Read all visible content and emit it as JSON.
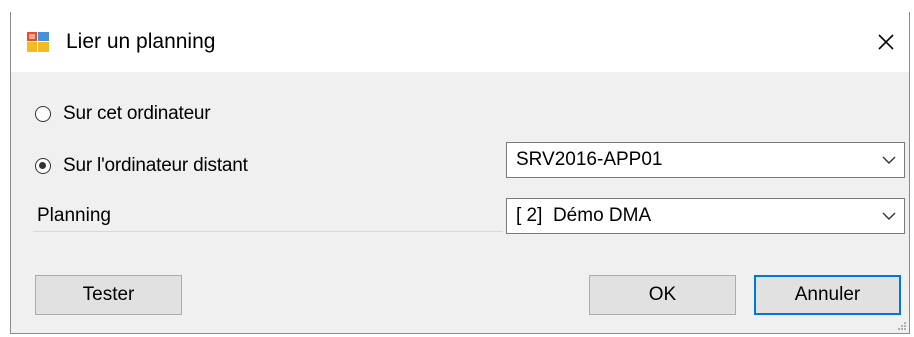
{
  "window": {
    "title": "Lier un planning",
    "close_glyph": "×"
  },
  "options": {
    "local_label": "Sur cet ordinateur",
    "remote_label": "Sur l'ordinateur distant",
    "selected": "remote"
  },
  "server_combo": {
    "value": "SRV2016-APP01"
  },
  "planning": {
    "label": "Planning",
    "value": "[ 2]  Démo DMA"
  },
  "buttons": {
    "test_label": "Tester",
    "ok_label": "OK",
    "cancel_label": "Annuler"
  },
  "icons": {
    "app": "app-window-icon",
    "close": "close-icon",
    "dropdown": "chevron-down-icon"
  },
  "colors": {
    "dialog_bg": "#f0f0f0",
    "accent": "#0078d7",
    "button_bg": "#e1e1e1"
  }
}
